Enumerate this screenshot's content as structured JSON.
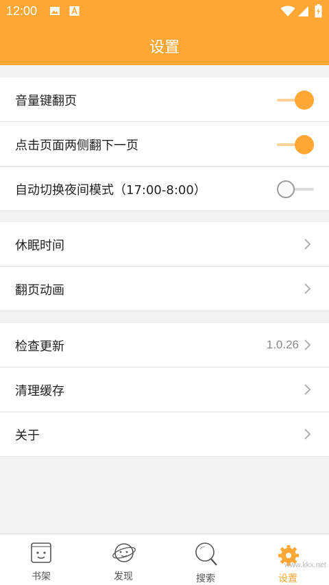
{
  "status_bar": {
    "time": "12:00",
    "icons": [
      "image-icon",
      "a-badge-icon",
      "wifi-icon",
      "cell-signal-icon",
      "battery-icon"
    ]
  },
  "app_bar": {
    "title": "设置"
  },
  "settings": {
    "group1": [
      {
        "label": "音量键翻页",
        "toggle": true
      },
      {
        "label": "点击页面两侧翻下一页",
        "toggle": true
      },
      {
        "label": "自动切换夜间模式（17:00-8:00）",
        "toggle": false
      }
    ],
    "group2": [
      {
        "label": "休眠时间"
      },
      {
        "label": "翻页动画"
      }
    ],
    "group3": [
      {
        "label": "检查更新",
        "value": "1.0.26"
      },
      {
        "label": "清理缓存"
      },
      {
        "label": "关于"
      }
    ]
  },
  "tabs": [
    {
      "label": "书架",
      "icon": "bookshelf-face-icon"
    },
    {
      "label": "发现",
      "icon": "planet-icon"
    },
    {
      "label": "搜索",
      "icon": "magnifier-icon"
    },
    {
      "label": "设置",
      "icon": "gear-icon",
      "active": true
    }
  ],
  "watermark": "www.kkx.net",
  "colors": {
    "accent": "#ffa735",
    "accent_light": "#ffd197",
    "background": "#f2f2f2"
  }
}
